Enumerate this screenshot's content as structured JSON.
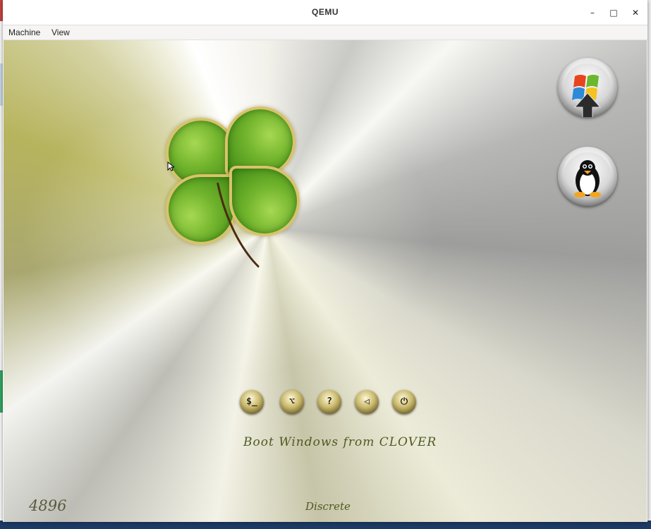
{
  "window": {
    "title": "QEMU",
    "controls": {
      "minimize": "–",
      "maximize": "□",
      "close": "✕"
    }
  },
  "menubar": {
    "items": [
      "Machine",
      "View"
    ]
  },
  "boot": {
    "entries": [
      {
        "name": "windows",
        "icon": "windows-logo-icon"
      },
      {
        "name": "linux",
        "icon": "tux-penguin-icon"
      }
    ],
    "tools": [
      {
        "icon": "shell-icon",
        "glyph": "$_"
      },
      {
        "icon": "options-icon",
        "glyph": "⌥"
      },
      {
        "icon": "help-icon",
        "glyph": "?"
      },
      {
        "icon": "back-icon",
        "glyph": "◁"
      },
      {
        "icon": "power-icon",
        "glyph": "⏻"
      }
    ],
    "status_message": "Boot Windows from CLOVER",
    "revision": "4896",
    "theme_name": "Discrete"
  },
  "colors": {
    "clover_green": "#6fb22b",
    "script_text": "#4f5a22"
  }
}
